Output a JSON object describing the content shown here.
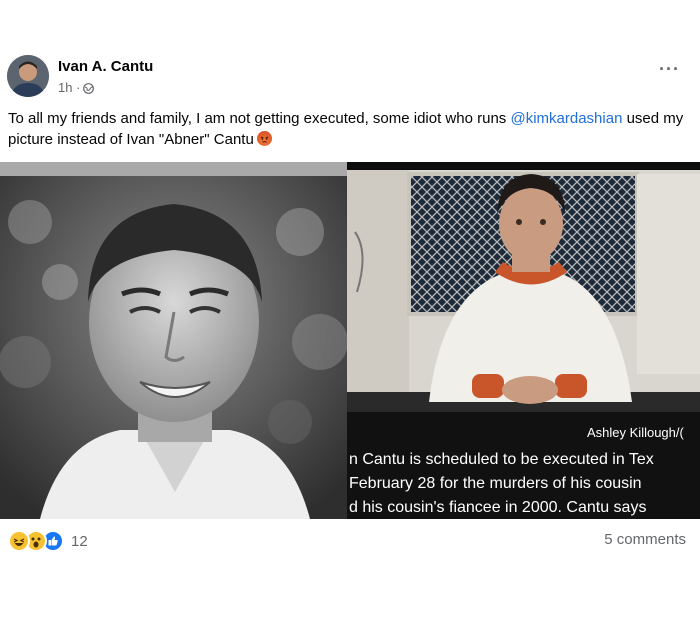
{
  "post": {
    "author": "Ivan A. Cantu",
    "time": "1h ·",
    "privacy_icon": "globe-icon",
    "more_icon": "more-options-icon",
    "caption_text": "To all my friends and family, I am not getting executed, some idiot who runs ",
    "caption_mention": "@kimkardashian",
    "caption_text_end": " used my picture instead of Ivan \"Abner\" Cantu",
    "caption_emoji": "angry-face-emoji"
  },
  "photos": {
    "left_image": "portrait-of-smiling-man",
    "right_image": "man-in-prison-visitation-room",
    "credit": "Ashley Killough/(",
    "news_lines": [
      "n Cantu is scheduled to be executed in Tex",
      "February 28 for the murders of his cousin",
      "d his cousin's fiancee in 2000. Cantu says"
    ]
  },
  "footer": {
    "reaction_icons": [
      "haha-reaction-icon",
      "wow-reaction-icon",
      "like-reaction-icon"
    ],
    "reaction_count": "12",
    "comments": "5 comments"
  }
}
